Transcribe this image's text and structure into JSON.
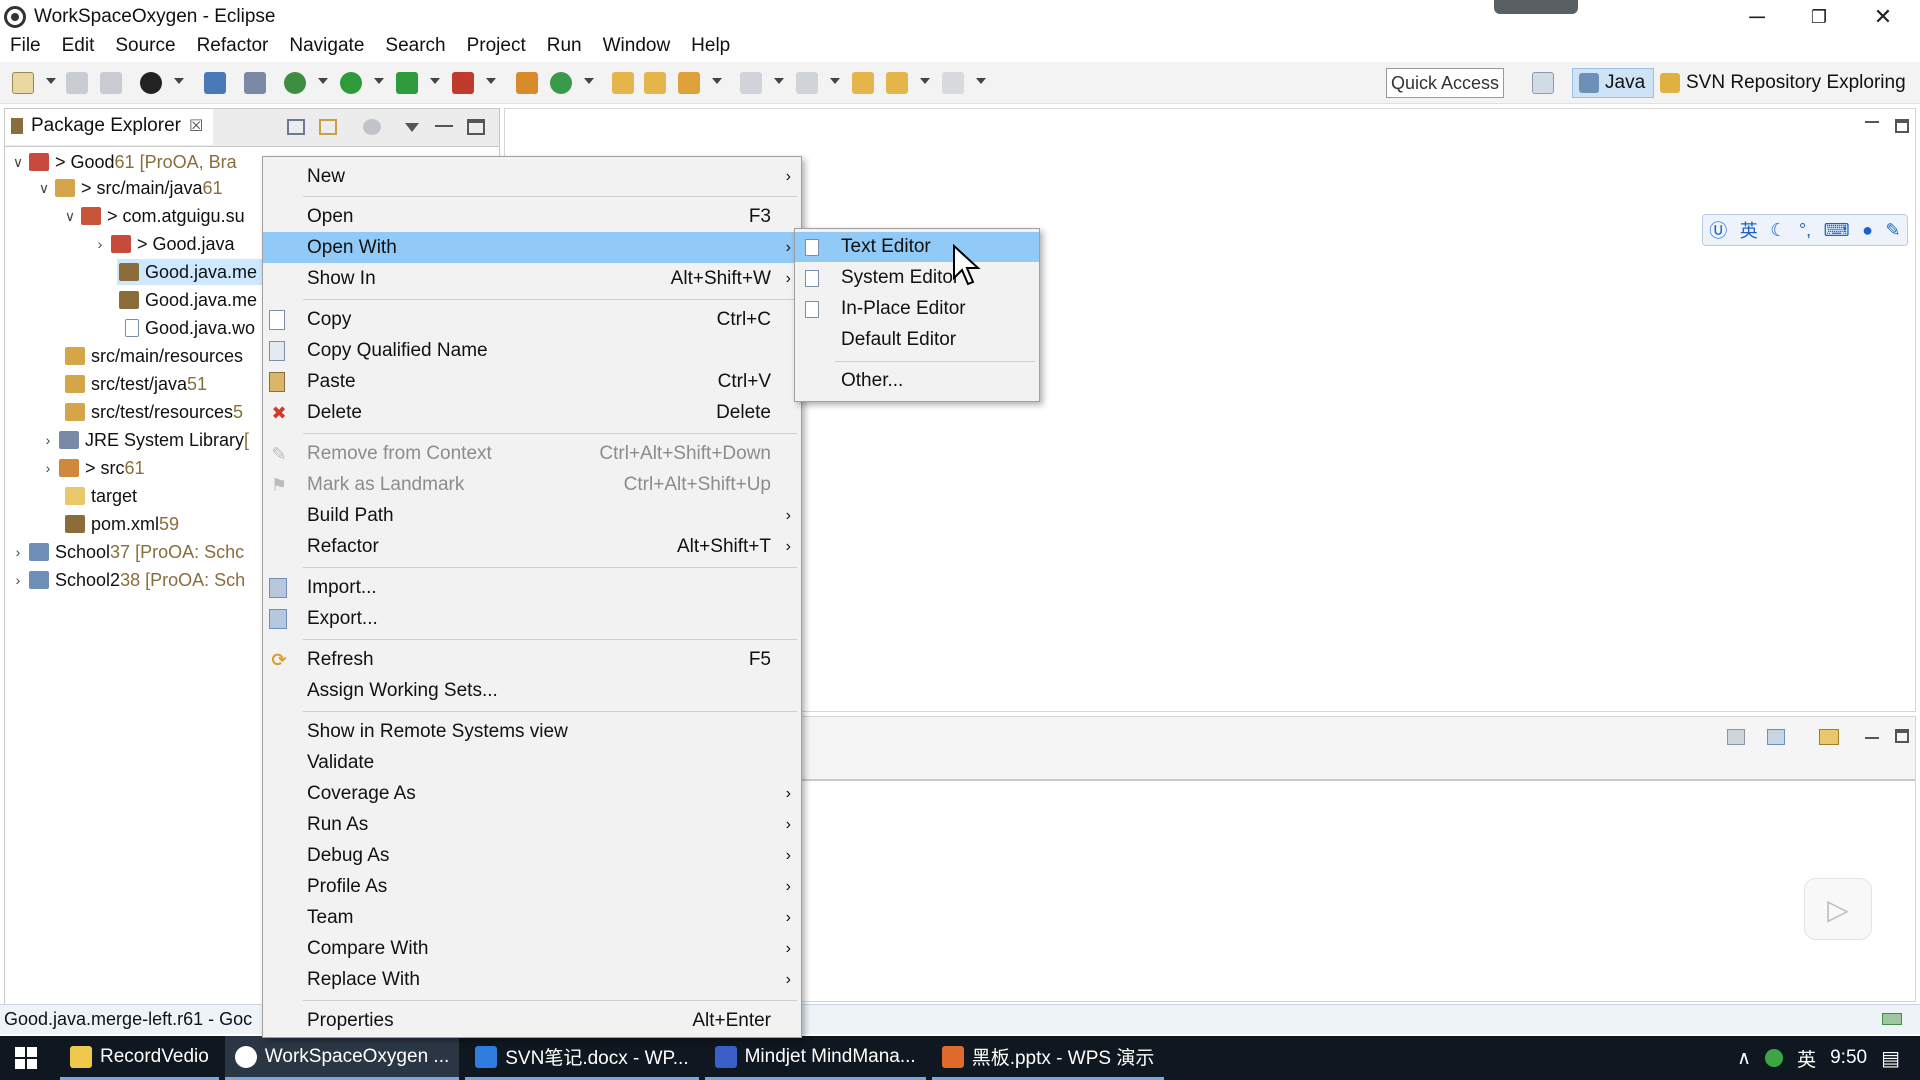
{
  "window": {
    "title": "WorkSpaceOxygen - Eclipse",
    "minimize": "─",
    "restore": "❐",
    "close": "✕"
  },
  "menubar": [
    "File",
    "Edit",
    "Source",
    "Refactor",
    "Navigate",
    "Search",
    "Project",
    "Run",
    "Window",
    "Help"
  ],
  "toolbar": {
    "quick_access": "Quick Access",
    "perspectives": [
      "Java",
      "SVN Repository Exploring"
    ]
  },
  "package_explorer": {
    "tab_label": "Package Explorer",
    "tree": [
      {
        "label": "> Good",
        "rev": " 61 [ProOA, Bra",
        "twisty": "∨"
      },
      {
        "label": "> src/main/java",
        "rev": " 61",
        "twisty": "∨"
      },
      {
        "label": "> com.atguigu.su",
        "rev": "",
        "twisty": "∨"
      },
      {
        "label": "> Good.java",
        "rev": "",
        "twisty": "›"
      },
      {
        "label": "Good.java.me",
        "rev": "",
        "twisty": ""
      },
      {
        "label": "Good.java.me",
        "rev": "",
        "twisty": ""
      },
      {
        "label": "Good.java.wo",
        "rev": "",
        "twisty": ""
      },
      {
        "label": "src/main/resources",
        "rev": "",
        "twisty": ""
      },
      {
        "label": "src/test/java",
        "rev": " 51",
        "twisty": ""
      },
      {
        "label": "src/test/resources",
        "rev": " 5",
        "twisty": ""
      },
      {
        "label": "JRE System Library",
        "rev": " [",
        "twisty": "›"
      },
      {
        "label": "> src",
        "rev": " 61",
        "twisty": "›"
      },
      {
        "label": "target",
        "rev": "",
        "twisty": ""
      },
      {
        "label": "pom.xml",
        "rev": " 59",
        "twisty": ""
      },
      {
        "label": "School",
        "rev": " 37 [ProOA: Schc",
        "twisty": "›"
      },
      {
        "label": "School2",
        "rev": " 38 [ProOA: Sch",
        "twisty": "›"
      }
    ]
  },
  "context_menu": [
    {
      "label": "New",
      "shortcut": "",
      "submenu": true
    },
    {
      "label": "Open",
      "shortcut": "F3"
    },
    {
      "label": "Open With",
      "shortcut": "",
      "submenu": true
    },
    {
      "label": "Show In",
      "shortcut": "Alt+Shift+W",
      "submenu": true
    },
    {
      "label": "Copy",
      "shortcut": "Ctrl+C"
    },
    {
      "label": "Copy Qualified Name",
      "shortcut": ""
    },
    {
      "label": "Paste",
      "shortcut": "Ctrl+V"
    },
    {
      "label": "Delete",
      "shortcut": "Delete"
    },
    {
      "label": "Remove from Context",
      "shortcut": "Ctrl+Alt+Shift+Down"
    },
    {
      "label": "Mark as Landmark",
      "shortcut": "Ctrl+Alt+Shift+Up"
    },
    {
      "label": "Build Path",
      "shortcut": "",
      "submenu": true
    },
    {
      "label": "Refactor",
      "shortcut": "Alt+Shift+T",
      "submenu": true
    },
    {
      "label": "Import...",
      "shortcut": ""
    },
    {
      "label": "Export...",
      "shortcut": ""
    },
    {
      "label": "Refresh",
      "shortcut": "F5"
    },
    {
      "label": "Assign Working Sets...",
      "shortcut": ""
    },
    {
      "label": "Show in Remote Systems view",
      "shortcut": ""
    },
    {
      "label": "Validate",
      "shortcut": ""
    },
    {
      "label": "Coverage As",
      "shortcut": "",
      "submenu": true
    },
    {
      "label": "Run As",
      "shortcut": "",
      "submenu": true
    },
    {
      "label": "Debug As",
      "shortcut": "",
      "submenu": true
    },
    {
      "label": "Profile As",
      "shortcut": "",
      "submenu": true
    },
    {
      "label": "Team",
      "shortcut": "",
      "submenu": true
    },
    {
      "label": "Compare With",
      "shortcut": "",
      "submenu": true
    },
    {
      "label": "Replace With",
      "shortcut": "",
      "submenu": true
    },
    {
      "label": "Properties",
      "shortcut": "Alt+Enter"
    }
  ],
  "open_with_submenu": [
    "Text Editor",
    "System Editor",
    "In-Place Editor",
    "Default Editor",
    "Other..."
  ],
  "ime": {
    "lang": "英"
  },
  "status": {
    "text": "Good.java.merge-left.r61 - Goc"
  },
  "taskbar": {
    "items": [
      "RecordVedio",
      "WorkSpaceOxygen ...",
      "SVN笔记.docx - WP...",
      "Mindjet MindMana...",
      "黑板.pptx - WPS 演示"
    ],
    "tray_lang": "英",
    "time": "9:50"
  },
  "colors": {
    "highlight": "#91c9f7",
    "menu_bg": "#f2f2f2",
    "taskbar": "#0f1720",
    "accent": "#1a63c9"
  }
}
